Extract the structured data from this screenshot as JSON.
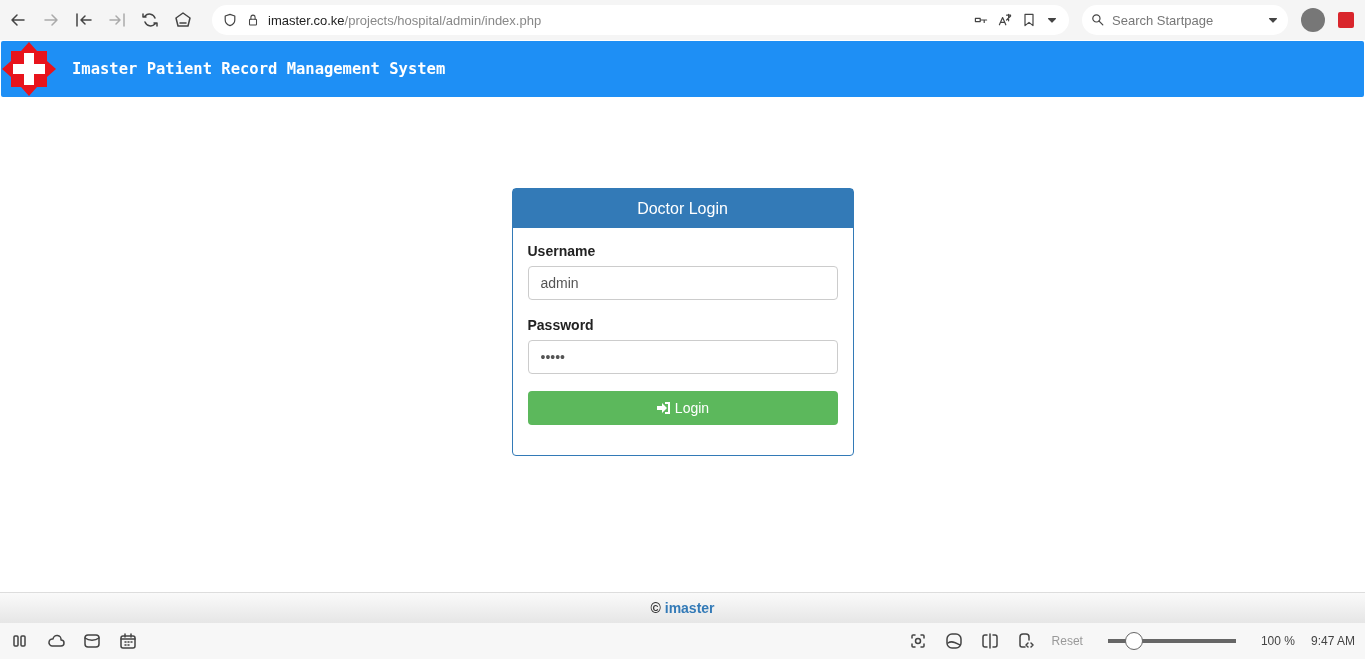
{
  "browser": {
    "url_host": "imaster.co.ke",
    "url_path": "/projects/hospital/admin/index.php",
    "search_placeholder": "Search Startpage"
  },
  "header": {
    "title": "Imaster Patient Record Management System"
  },
  "login": {
    "title": "Doctor Login",
    "fields": [
      {
        "label": "Username",
        "value": "admin"
      },
      {
        "label": "Password",
        "value": "•••••"
      }
    ],
    "button": "Login"
  },
  "footer": {
    "symbol": "©",
    "link": "imaster"
  },
  "status_bar": {
    "reset": "Reset",
    "zoom": {
      "level": 0.2
    },
    "zoom_reading": "100 %",
    "time": "9:47 AM"
  }
}
